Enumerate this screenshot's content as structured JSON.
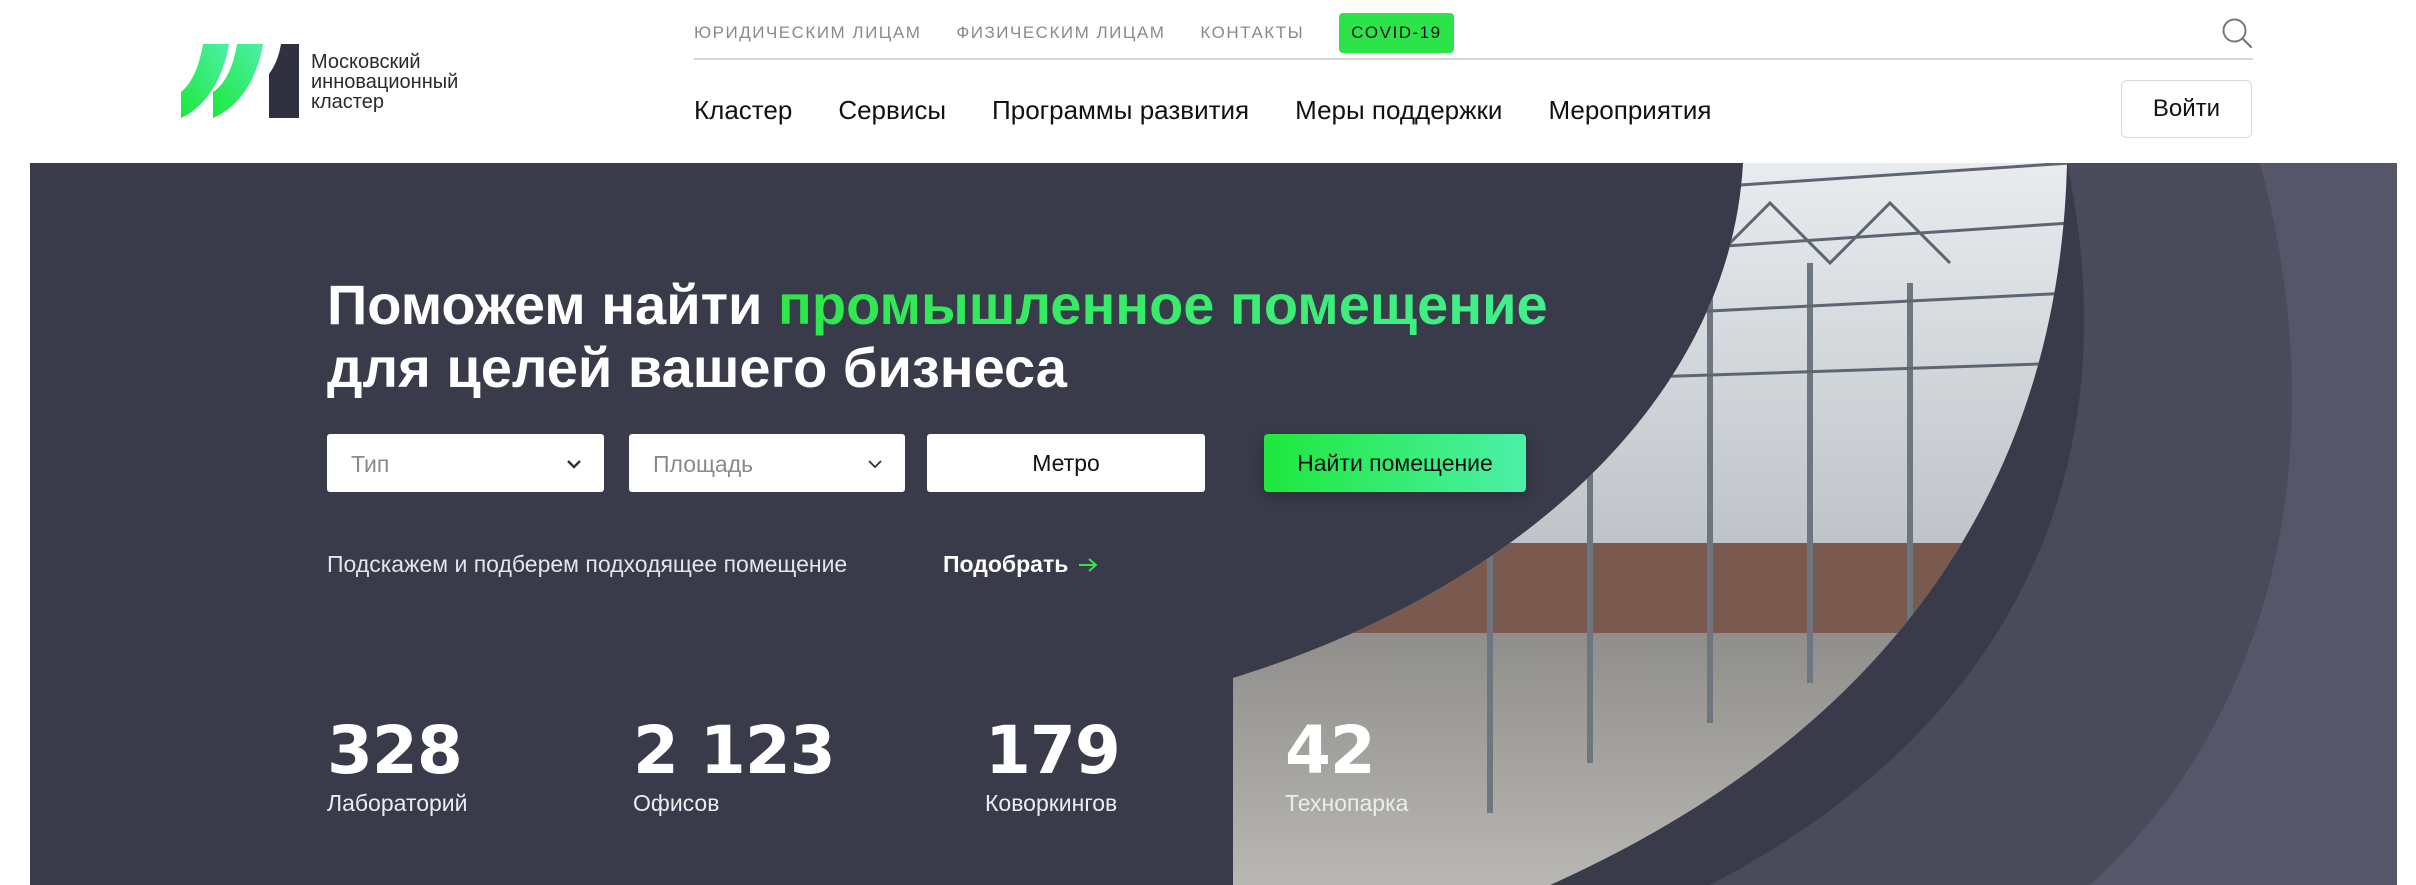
{
  "logo": {
    "lines": [
      "Московский",
      "инновационный",
      "кластер"
    ]
  },
  "top_nav": {
    "links": [
      "ЮРИДИЧЕСКИМ ЛИЦАМ",
      "ФИЗИЧЕСКИМ ЛИЦАМ",
      "КОНТАКТЫ"
    ],
    "covid": "COVID-19"
  },
  "main_nav": {
    "links": [
      "Кластер",
      "Сервисы",
      "Программы развития",
      "Меры поддержки",
      "Мероприятия"
    ]
  },
  "login_label": "Войти",
  "hero": {
    "title_part1": "Поможем найти ",
    "title_accent": "промышленное помещение",
    "title_part2": "для целей вашего бизнеса",
    "filters": {
      "type_placeholder": "Тип",
      "area_placeholder": "Площадь",
      "metro_label": "Метро",
      "find_label": "Найти помещение"
    },
    "hint_text": "Подскажем и подберем подходящее помещение",
    "pick_label": "Подобрать"
  },
  "stats": [
    {
      "value": "328",
      "label": "Лабораторий"
    },
    {
      "value": "2 123",
      "label": "Офисов"
    },
    {
      "value": "179",
      "label": "Коворкингов"
    },
    {
      "value": "42",
      "label": "Технопарка"
    }
  ],
  "colors": {
    "accent_green": "#2ee84a",
    "hero_bg": "#3a3b4a",
    "hero_shape": "#4a4b5a"
  },
  "icons": {
    "search": "search-icon",
    "chevron": "chevron-down-icon",
    "arrow": "arrow-right-icon"
  }
}
